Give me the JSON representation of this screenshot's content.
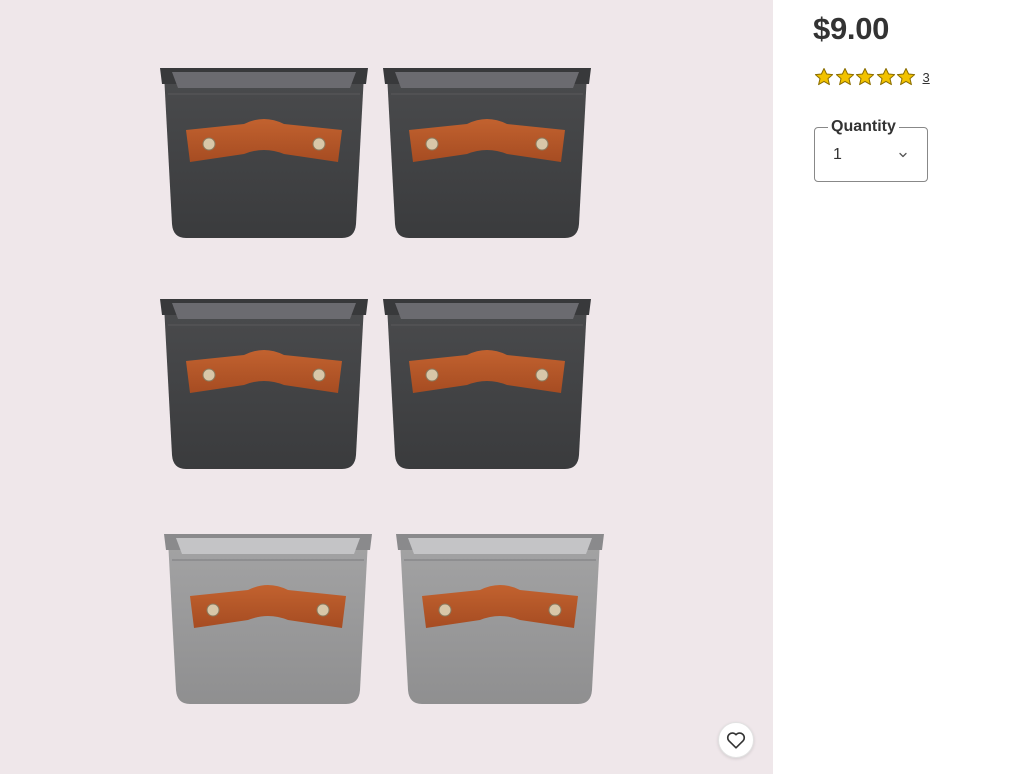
{
  "product": {
    "price": "$9.00",
    "rating": {
      "stars": 5,
      "max": 5,
      "count": "3"
    },
    "quantity": {
      "label": "Quantity",
      "value": "1"
    }
  },
  "gallery": {
    "image": "six felt storage bins (four dark gray, two light gray) with brown leather handles"
  },
  "icons": [
    "star-icon",
    "chevron-down-icon",
    "heart-icon"
  ],
  "colors": {
    "gallery_bg": "#efe7ea",
    "star": "#f2c200",
    "star_outline": "#8a6d00",
    "text": "#333333",
    "dark_felt": "#414244",
    "light_felt": "#9a9a9b",
    "leather": "#b5562a"
  }
}
